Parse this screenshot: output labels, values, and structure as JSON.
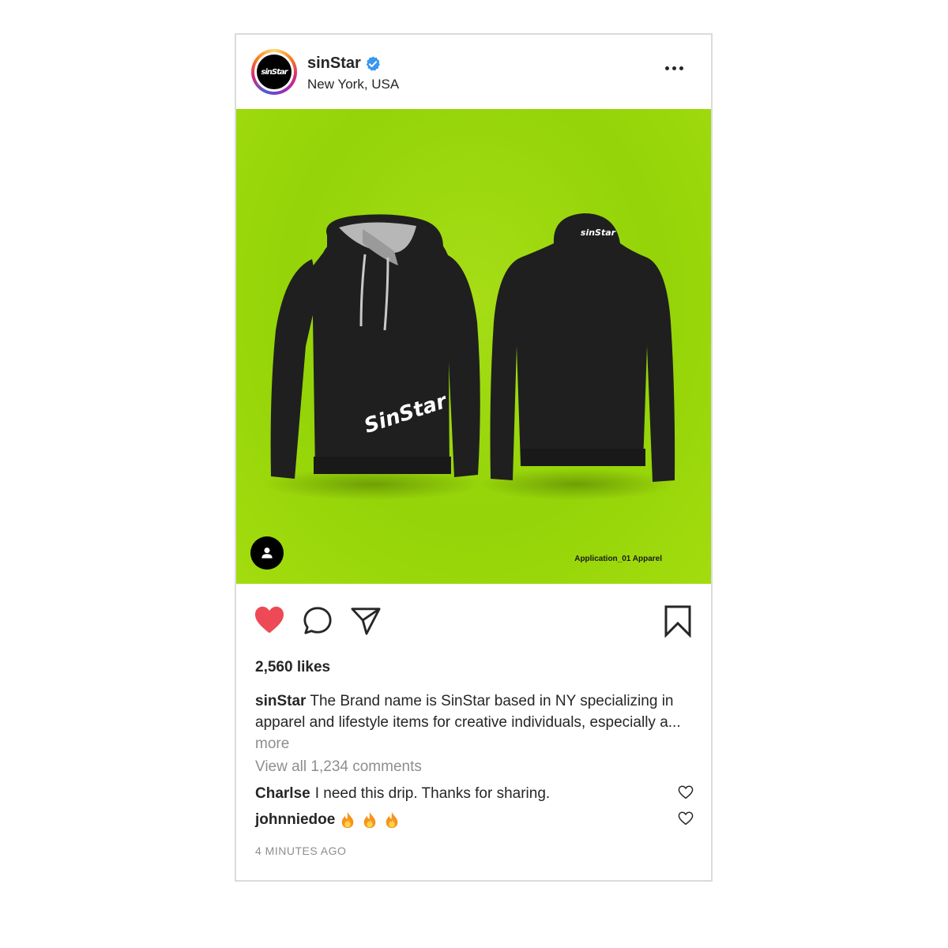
{
  "post": {
    "username": "sinStar",
    "location": "New York, USA",
    "avatar_text": "sinStar",
    "image_caption": "Application_01 Apparel",
    "hoodie_logo_front": "SinStar",
    "hoodie_logo_back": "sinStar",
    "likes": "2,560 likes",
    "caption_user": "sinStar",
    "caption_text": "The Brand name is SinStar based in NY specializing in apparel and lifestyle items for creative individuals, especially a...",
    "caption_more": "more",
    "view_all": "View all 1,234 comments",
    "comments": [
      {
        "user": "Charlse",
        "text": "I need this drip. Thanks for sharing."
      },
      {
        "user": "johnniedoe",
        "text": ""
      }
    ],
    "timestamp": "4 MINUTES AGO"
  },
  "colors": {
    "like_red": "#ed4956",
    "verified_blue": "#3897f0",
    "photo_bg": "#9cd80c",
    "hoodie": "#1f1f1f"
  },
  "icons": {
    "more": "more-dots-icon",
    "like": "heart-filled-icon",
    "comment": "comment-bubble-icon",
    "share": "paper-plane-icon",
    "save": "bookmark-icon",
    "tag": "user-tag-icon",
    "flame": "fire-emoji-icon"
  }
}
